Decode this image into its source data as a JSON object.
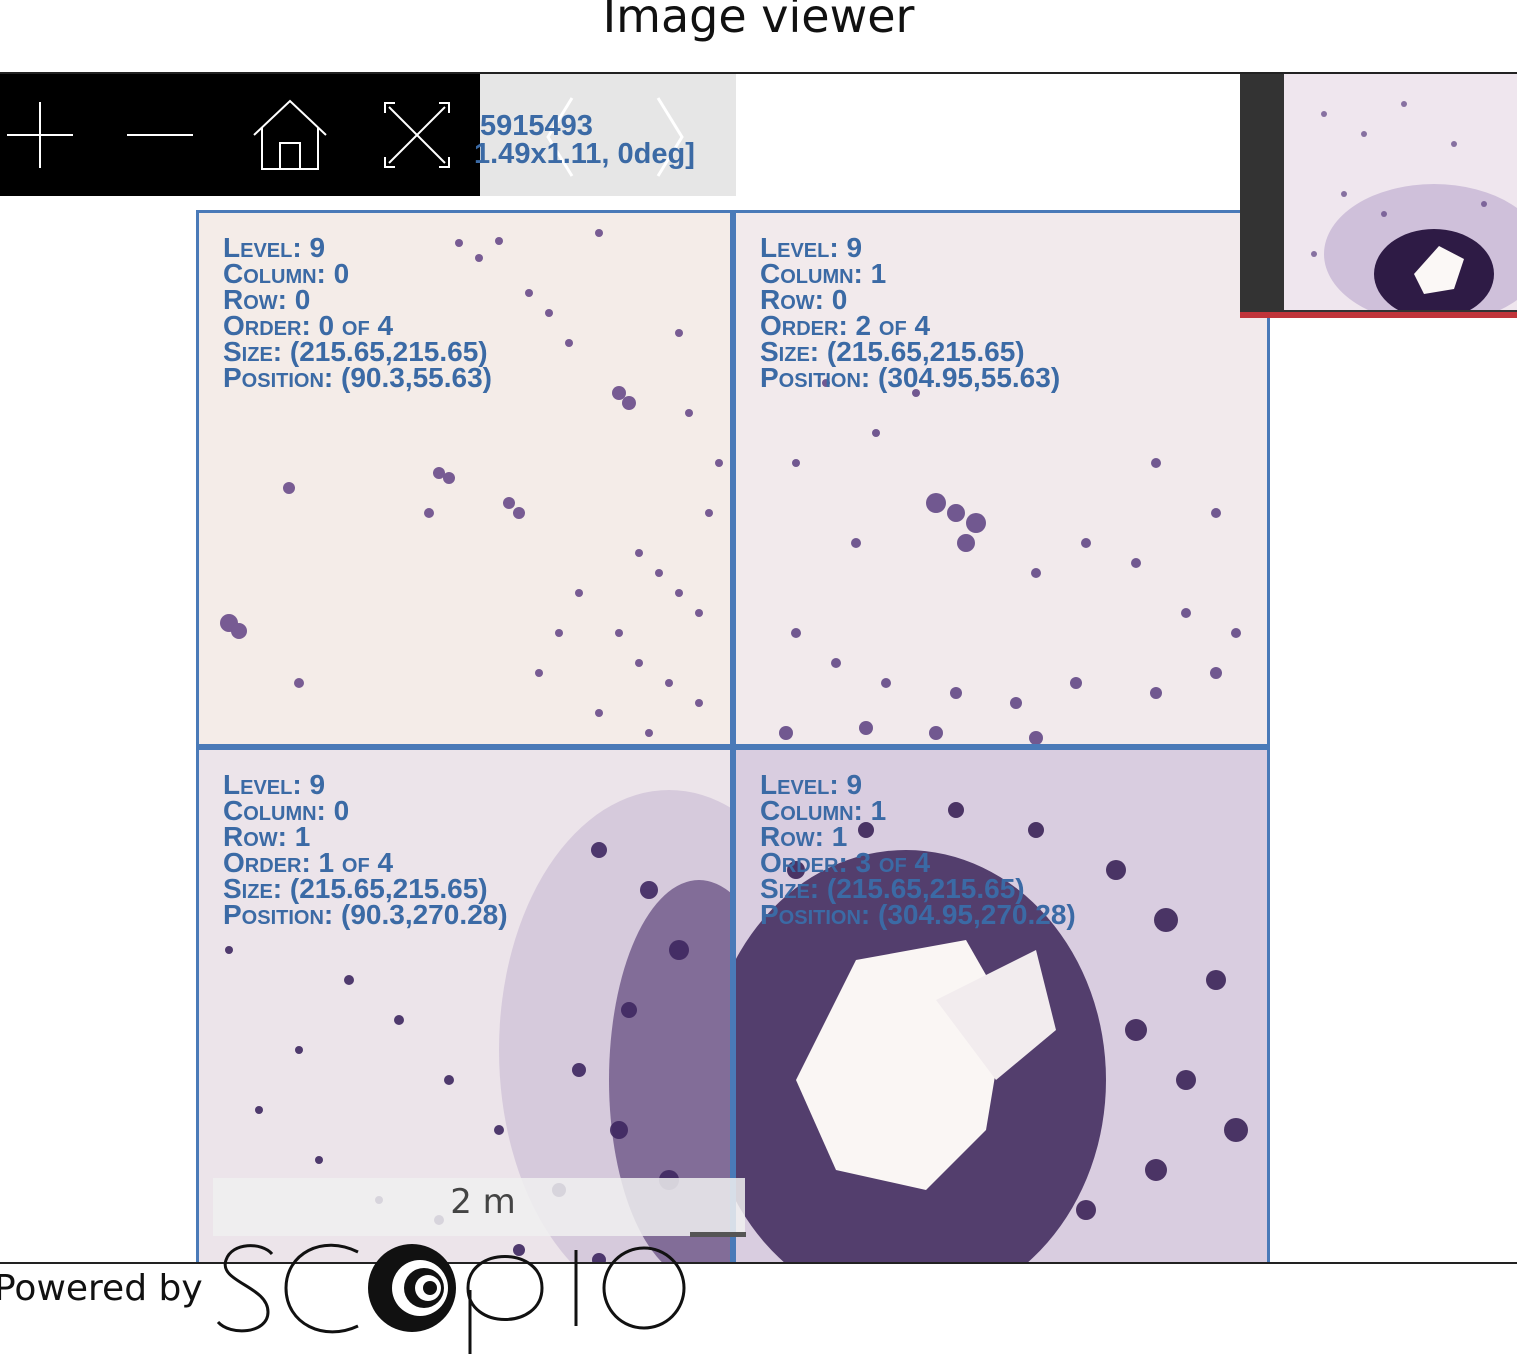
{
  "header": {
    "title": "Image viewer"
  },
  "toolbar": {
    "icons": [
      "zoom-in-icon",
      "zoom-out-icon",
      "home-icon",
      "fullscreen-icon"
    ]
  },
  "nav_info": {
    "line1": "5915493",
    "line2": "1.49x1.11, 0deg]"
  },
  "tiles": [
    {
      "level": "Level: 9",
      "column": "Column: 0",
      "row": "Row: 0",
      "order": "Order: 0 of 4",
      "size": "Size: (215.65,215.65)",
      "position": "Position: (90.3,55.63)"
    },
    {
      "level": "Level: 9",
      "column": "Column: 1",
      "row": "Row: 0",
      "order": "Order: 2 of 4",
      "size": "Size: (215.65,215.65)",
      "position": "Position: (304.95,55.63)"
    },
    {
      "level": "Level: 9",
      "column": "Column: 0",
      "row": "Row: 1",
      "order": "Order: 1 of 4",
      "size": "Size: (215.65,215.65)",
      "position": "Position: (90.3,270.28)"
    },
    {
      "level": "Level: 9",
      "column": "Column: 1",
      "row": "Row: 1",
      "order": "Order: 3 of 4",
      "size": "Size: (215.65,215.65)",
      "position": "Position: (304.95,270.28)"
    }
  ],
  "scale": {
    "label": "2 m"
  },
  "footer": {
    "powered_by": "Powered by",
    "brand": "SCOPIO"
  },
  "colors": {
    "tile_border": "#4a7ab8",
    "info_text": "#3b6aa5",
    "stain": "#4b2d6e",
    "navigator_indicator": "#c0343a"
  }
}
